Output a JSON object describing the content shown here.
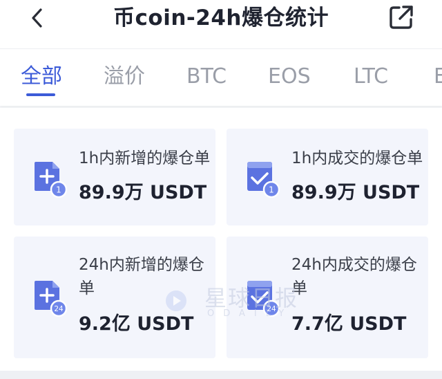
{
  "header": {
    "title": "币coin-24h爆仓统计",
    "back_icon": "chevron-left-icon",
    "share_icon": "external-share-icon"
  },
  "tabs": [
    {
      "label": "全部",
      "active": true
    },
    {
      "label": "溢价",
      "active": false
    },
    {
      "label": "BTC",
      "active": false
    },
    {
      "label": "EOS",
      "active": false
    },
    {
      "label": "LTC",
      "active": false
    },
    {
      "label": "E",
      "active": false
    }
  ],
  "cards": [
    {
      "label": "1h内新增的爆仓单",
      "value": "89.9万 USDT",
      "icon": "add-order-icon",
      "badge": "1"
    },
    {
      "label": "1h内成交的爆仓单",
      "value": "89.9万 USDT",
      "icon": "filled-order-icon",
      "badge": "1"
    },
    {
      "label": "24h内新增的爆仓单",
      "value": "9.2亿 USDT",
      "icon": "add-order-icon",
      "badge": "24"
    },
    {
      "label": "24h内成交的爆仓单",
      "value": "7.7亿 USDT",
      "icon": "filled-order-icon",
      "badge": "24"
    }
  ],
  "watermark": {
    "cn": "星球日报",
    "en": "ODAILY"
  },
  "colors": {
    "accent": "#3c5bd8",
    "tab_inactive": "#9a9ea8",
    "card_bg": "#f3f5fc",
    "icon_blue": "#5b72e0",
    "badge_blue": "#6f86ea"
  }
}
